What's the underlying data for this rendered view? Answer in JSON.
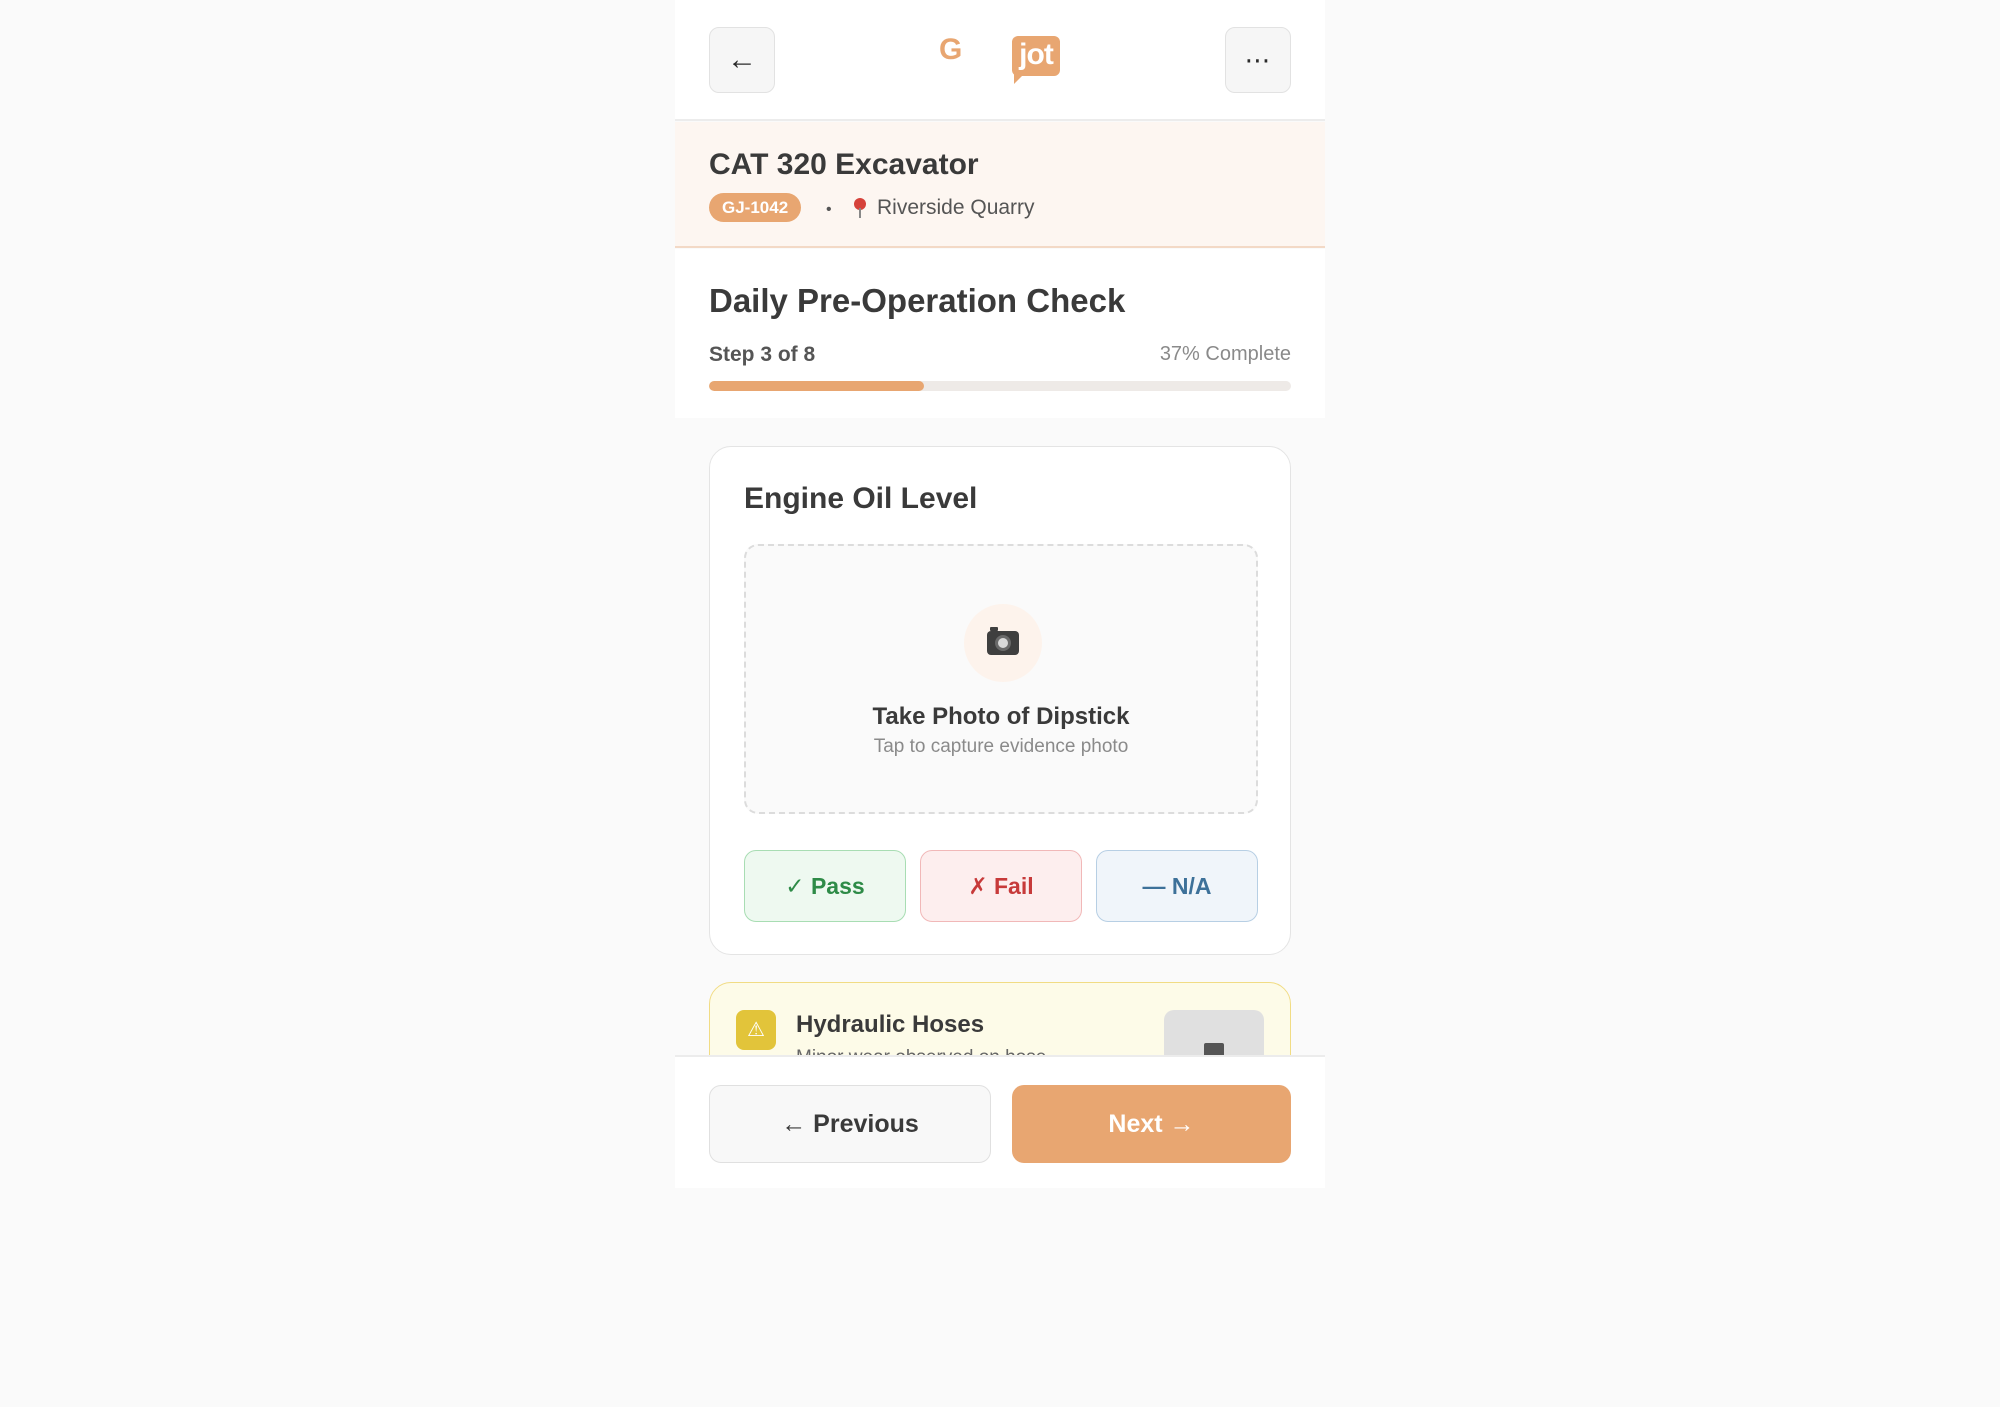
{
  "header": {
    "back_icon": "←",
    "menu_icon": "⋯",
    "logo_g": "G",
    "logo_jot": "jot"
  },
  "equipment": {
    "name": "CAT 320 Excavator",
    "tag": "GJ-1042",
    "separator": "•",
    "location": "Riverside Quarry"
  },
  "check": {
    "title": "Daily Pre-Operation Check",
    "step_label": "Step 3 of 8",
    "progress_label": "37% Complete",
    "progress_value": 0.37
  },
  "current_item": {
    "title": "Engine Oil Level",
    "photo_title": "Take Photo of Dipstick",
    "photo_subtitle": "Tap to capture evidence photo",
    "options": {
      "pass": "✓ Pass",
      "fail": "✗ Fail",
      "na": "— N/A"
    }
  },
  "next_item": {
    "warn_icon": "⚠",
    "title": "Hydraulic Hoses",
    "subtitle": "Minor wear observed on hose"
  },
  "footer": {
    "previous_label": "← Previous",
    "next_label": "Next →"
  },
  "colors": {
    "accent": "#e8a671",
    "pass": "#2e8b47",
    "fail": "#c73a3a",
    "na": "#3d7199",
    "warning": "#e2c43a"
  }
}
